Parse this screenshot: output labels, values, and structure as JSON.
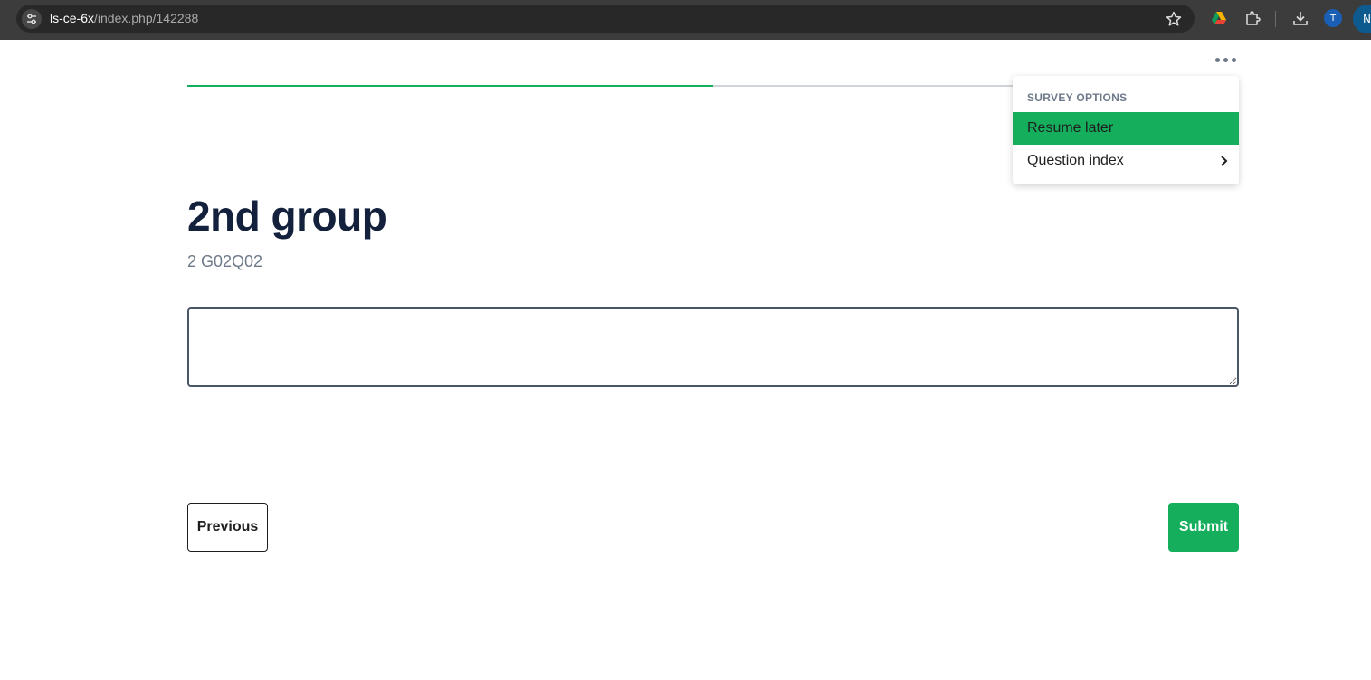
{
  "browser": {
    "url_host": "ls-ce-6x",
    "url_path": "/index.php/142288",
    "profile_small": "T",
    "profile_large": "N",
    "icons": [
      "tune-icon",
      "bookmark-star-icon",
      "drive-icon",
      "extensions-icon",
      "download-icon"
    ]
  },
  "survey": {
    "progress_fraction": 0.5,
    "group_title": "2nd group",
    "question_label": "2 G02Q02",
    "answer_value": "",
    "colors": {
      "accent": "#14ae5c",
      "title": "#14213d",
      "muted": "#6e7a8a"
    }
  },
  "options_menu": {
    "header": "SURVEY OPTIONS",
    "items": [
      {
        "label": "Resume later",
        "active": true
      },
      {
        "label": "Question index",
        "has_submenu": true
      }
    ]
  },
  "navigation": {
    "previous_label": "Previous",
    "submit_label": "Submit"
  }
}
